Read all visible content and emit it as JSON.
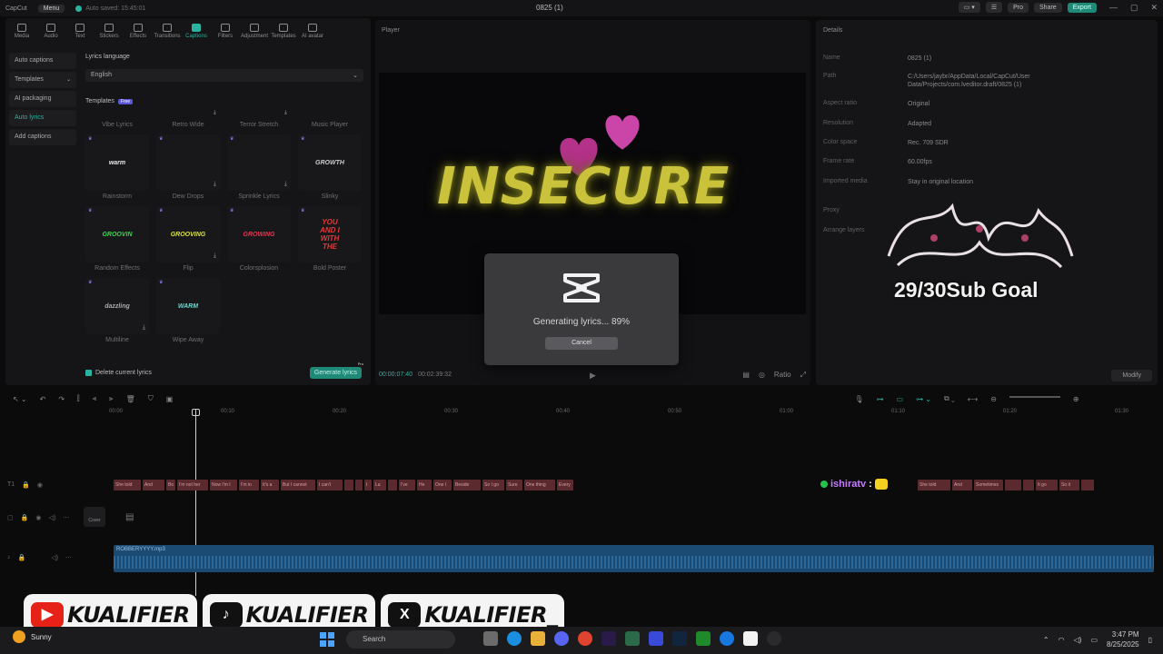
{
  "titlebar": {
    "app": "CapCut",
    "menu": "Menu",
    "autosave": "Auto saved: 15:45:01",
    "project": "0825 (1)",
    "pro": "Pro",
    "share": "Share",
    "export": "Export"
  },
  "toolbar": [
    "Media",
    "Audio",
    "Text",
    "Stickers",
    "Effects",
    "Transitions",
    "Captions",
    "Filters",
    "Adjustment",
    "Templates",
    "AI avatar"
  ],
  "sidemenu": [
    {
      "label": "Auto captions"
    },
    {
      "label": "Templates"
    },
    {
      "label": "AI packaging"
    },
    {
      "label": "Auto lyrics"
    },
    {
      "label": "Add captions"
    }
  ],
  "lyrics": {
    "language_label": "Lyrics language",
    "language_value": "English",
    "templates_label": "Templates",
    "new_badge": "Free"
  },
  "templates": [
    {
      "name": "Vibe Lyrics",
      "sample": ""
    },
    {
      "name": "Retro Wide",
      "sample": ""
    },
    {
      "name": "Terror Stretch",
      "sample": ""
    },
    {
      "name": "Music Player",
      "sample": ""
    },
    {
      "name": "Rainstorm",
      "sample": "warm"
    },
    {
      "name": "Dew Drops",
      "sample": ""
    },
    {
      "name": "Sprinkle Lyrics",
      "sample": ""
    },
    {
      "name": "Slinky",
      "sample": "GROWTH"
    },
    {
      "name": "Random Effects",
      "sample": "GROOVIN"
    },
    {
      "name": "Flip",
      "sample": "GROOVING"
    },
    {
      "name": "Colorsplosion",
      "sample": "GROWING"
    },
    {
      "name": "Bold Poster",
      "sample": "YOU AND I WITH THE"
    },
    {
      "name": "Multiline",
      "sample": "dazzling"
    },
    {
      "name": "Wipe Away",
      "sample": "WARM"
    }
  ],
  "bottom": {
    "delete_label": "Delete current lyrics",
    "generate": "Generate lyrics",
    "pro": "Pro"
  },
  "player": {
    "label": "Player",
    "overlay_text": "INSECURE",
    "time_current": "00:00:07:40",
    "time_total": "00:02:39:32",
    "ratio": "Ratio"
  },
  "details": {
    "label": "Details",
    "rows": [
      {
        "k": "Name",
        "v": "0825 (1)"
      },
      {
        "k": "Path",
        "v": "C:/Users/jaybr/AppData/Local/CapCut/User Data/Projects/com.lveditor.draft/0825 (1)"
      },
      {
        "k": "Aspect ratio",
        "v": "Original"
      },
      {
        "k": "Resolution",
        "v": "Adapted"
      },
      {
        "k": "Color space",
        "v": "Rec. 709 SDR"
      },
      {
        "k": "Frame rate",
        "v": "60.00fps"
      },
      {
        "k": "Imported media",
        "v": "Stay in original location"
      },
      {
        "k": "Proxy",
        "v": ""
      },
      {
        "k": "Arrange layers",
        "v": ""
      }
    ],
    "modify": "Modify"
  },
  "overlay_goal": "29/30Sub Goal",
  "modal": {
    "text": "Generating lyrics... 89%",
    "progress": 89,
    "cancel": "Cancel"
  },
  "timeline": {
    "ruler": [
      "00:00",
      "00:10",
      "00:20",
      "00:30",
      "00:40",
      "00:50",
      "01:00",
      "01:10",
      "01:20",
      "01:30"
    ],
    "lyric_clips": [
      "She told",
      "And",
      "Bo",
      "I'm not her",
      "Now I'm I",
      "I'm in",
      "It's a",
      "But I cannot",
      "I can't",
      "",
      "",
      "I",
      "La",
      "",
      "I've",
      "He",
      "One I",
      "Beside",
      "So I go",
      "Sure",
      "One thing",
      "Every"
    ],
    "lyric_clips_right": [
      "She told",
      "And",
      "Sometimes",
      "",
      "",
      "It go",
      "So it",
      ""
    ],
    "cover": "Cover",
    "audio_name": "ROBBERYYYY.mp3",
    "chat_user": "ishiratv",
    "chat_sep": ":"
  },
  "socials": [
    {
      "icon": "youtube-icon",
      "name": "KUALIFIER",
      "color": "#e62117"
    },
    {
      "icon": "tiktok-icon",
      "name": "KUALIFIER",
      "color": "#111111"
    },
    {
      "icon": "x-icon",
      "name": "KUALIFIER_",
      "color": "#111111"
    }
  ],
  "taskbar": {
    "weather_label": "Sunny",
    "search": "Search",
    "time": "3:47 PM",
    "date": "8/25/2025"
  }
}
